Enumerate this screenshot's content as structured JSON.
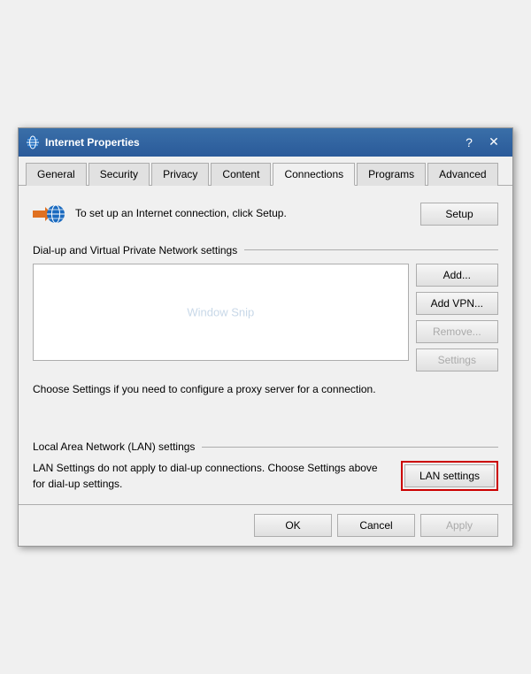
{
  "window": {
    "title": "Internet Properties",
    "help_btn": "?",
    "close_btn": "✕"
  },
  "tabs": [
    {
      "id": "general",
      "label": "General",
      "active": false
    },
    {
      "id": "security",
      "label": "Security",
      "active": false
    },
    {
      "id": "privacy",
      "label": "Privacy",
      "active": false
    },
    {
      "id": "content",
      "label": "Content",
      "active": false
    },
    {
      "id": "connections",
      "label": "Connections",
      "active": true
    },
    {
      "id": "programs",
      "label": "Programs",
      "active": false
    },
    {
      "id": "advanced",
      "label": "Advanced",
      "active": false
    }
  ],
  "setup": {
    "text": "To set up an Internet connection, click Setup.",
    "button_label": "Setup"
  },
  "vpn_section": {
    "header": "Dial-up and Virtual Private Network settings",
    "listbox_watermark": "Window Snip",
    "add_label": "Add...",
    "add_vpn_label": "Add VPN...",
    "remove_label": "Remove...",
    "settings_label": "Settings"
  },
  "proxy": {
    "text": "Choose Settings if you need to configure a proxy server for a connection."
  },
  "lan_section": {
    "header": "Local Area Network (LAN) settings",
    "text": "LAN Settings do not apply to dial-up connections. Choose Settings above for dial-up settings.",
    "button_label": "LAN settings"
  },
  "bottom": {
    "ok_label": "OK",
    "cancel_label": "Cancel",
    "apply_label": "Apply"
  }
}
